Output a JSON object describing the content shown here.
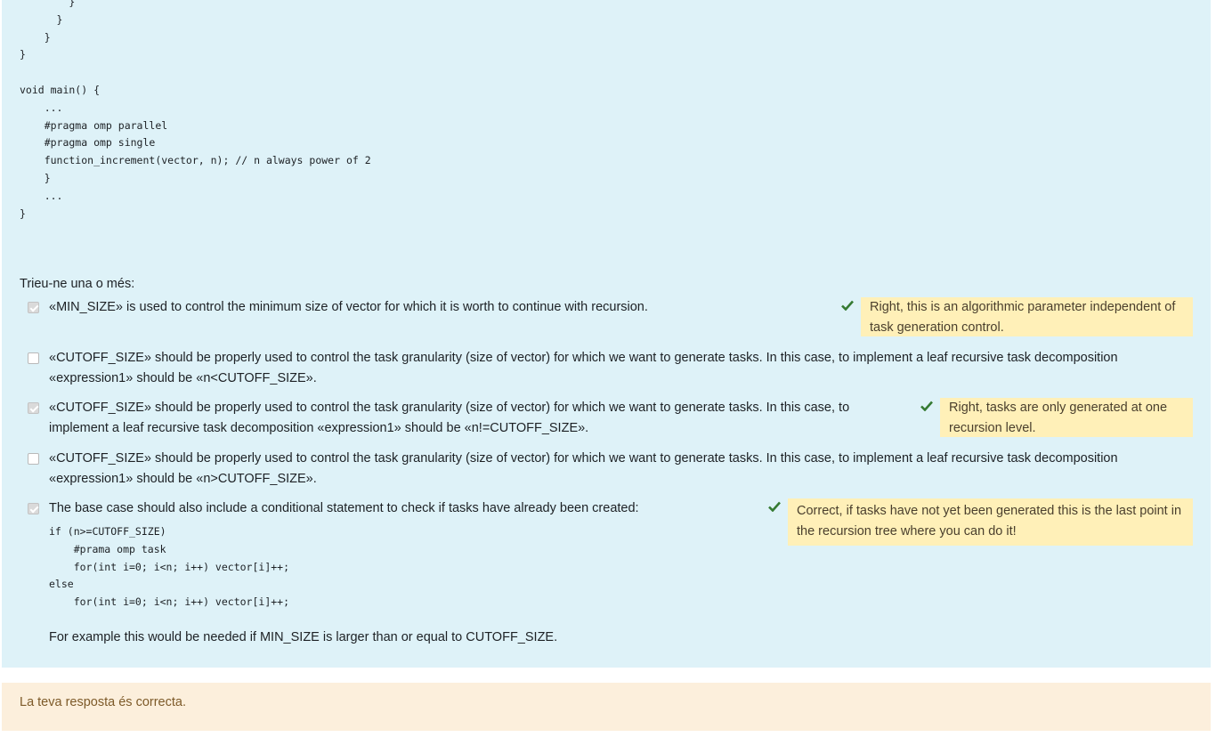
{
  "code_top": "        }\n      }\n    }\n}\n\nvoid main() {\n    ...\n    #pragma omp parallel\n    #pragma omp single\n    function_increment(vector, n); // n always power of 2\n    }\n    ...\n}",
  "prompt": "Trieu-ne una o més:",
  "options": [
    {
      "text": "«MIN_SIZE» is used to control the minimum size of vector for which it is worth to continue with recursion.",
      "checked": true,
      "feedback": "Right, this is an algorithmic parameter independent of task generation control."
    },
    {
      "text": "«CUTOFF_SIZE» should be properly used to control the task granularity (size of vector) for which we want to generate tasks. In this case, to implement a leaf recursive task decomposition «expression1» should be «n<CUTOFF_SIZE».",
      "checked": false
    },
    {
      "text": "«CUTOFF_SIZE» should be properly used to control the task granularity (size of vector) for which we want to generate tasks. In this case, to implement a leaf recursive task decomposition «expression1» should be «n!=CUTOFF_SIZE».",
      "checked": true,
      "feedback": "Right, tasks are only generated at one recursion level."
    },
    {
      "text": "«CUTOFF_SIZE» should be properly used to control the task granularity (size of vector) for which we want to generate tasks. In this case, to implement a leaf recursive task decomposition «expression1» should be «n>CUTOFF_SIZE».",
      "checked": false
    },
    {
      "text": "The base case should also include a conditional statement to check if tasks have already been created:",
      "code": "if (n>=CUTOFF_SIZE)\n    #prama omp task\n    for(int i=0; i<n; i++) vector[i]++;\nelse\n    for(int i=0; i<n; i++) vector[i]++;",
      "note": "For example this would be needed if MIN_SIZE is larger than or equal to CUTOFF_SIZE.",
      "checked": true,
      "feedback": "Correct, if tasks have not yet been generated this is the last point in the recursion tree where you can do it!"
    }
  ],
  "outcome": "La teva resposta és correcta.",
  "colors": {
    "question_bg": "#def2f8",
    "feedback_bg": "#fff0b8",
    "outcome_bg": "#fcefdc",
    "tick": "#357a32"
  }
}
